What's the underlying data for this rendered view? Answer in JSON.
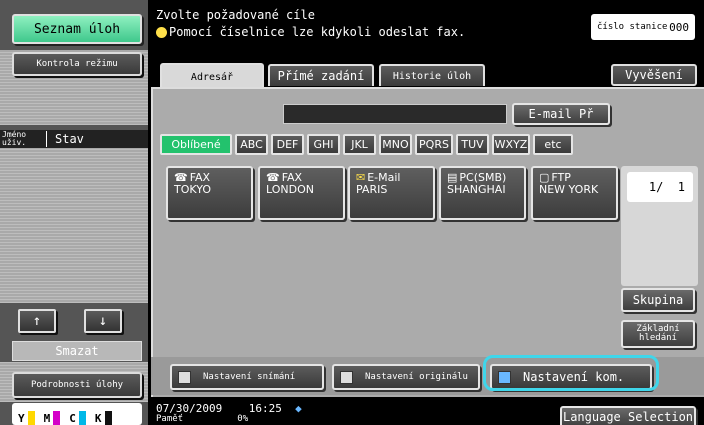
{
  "left": {
    "job_list_label": "Seznam úloh",
    "mode_check_label": "Kontrola režimu",
    "col_user_label": "Jméno uživ.",
    "col_status_label": "Stav",
    "up_arrow": "↑",
    "down_arrow": "↓",
    "delete_label": "Smazat",
    "details_label": "Podrobnosti úlohy",
    "toner": [
      "Y",
      "M",
      "C",
      "K"
    ],
    "toner_colors": [
      "#ffd800",
      "#d400c8",
      "#00b8e8",
      "#111111"
    ]
  },
  "header": {
    "title": "Zvolte požadované cíle",
    "subtitle": "Pomocí číselnice lze kdykoli odeslat fax.",
    "station_label": "číslo stanice",
    "station_value": "000"
  },
  "tabs": {
    "address_book": "Adresář",
    "direct_entry": "Přímé zadání",
    "job_history": "Historie úloh",
    "publish": "Vyvěšení"
  },
  "search": {
    "email_button": "E-mail Př"
  },
  "index_keys": [
    "Oblíbené",
    "ABC",
    "DEF",
    "GHI",
    "JKL",
    "MNO",
    "PQRS",
    "TUV",
    "WXYZ",
    "etc"
  ],
  "destinations": [
    {
      "type": "FAX",
      "name": "TOKYO",
      "icon": "☎"
    },
    {
      "type": "FAX",
      "name": "LONDON",
      "icon": "☎"
    },
    {
      "type": "E-Mail",
      "name": "PARIS",
      "icon": "✉"
    },
    {
      "type": "PC(SMB)",
      "name": "SHANGHAI",
      "icon": "▤"
    },
    {
      "type": "FTP",
      "name": "NEW YORK",
      "icon": "▢"
    }
  ],
  "paging": {
    "page": "1/",
    "total": "1"
  },
  "side_buttons": {
    "group": "Skupina",
    "basic_search": "Základní hledání"
  },
  "bottom_buttons": {
    "scan_settings": "Nastavení snímání",
    "original_settings": "Nastavení originálu",
    "comm_settings": "Nastavení kom."
  },
  "footer": {
    "date": "07/30/2009",
    "time": "16:25",
    "memory_label": "Paměť",
    "memory_value": "0%",
    "language_button": "Language Selection"
  },
  "colors": {
    "accent_green": "#23c26d",
    "highlight_cyan": "#3fd6ea"
  }
}
